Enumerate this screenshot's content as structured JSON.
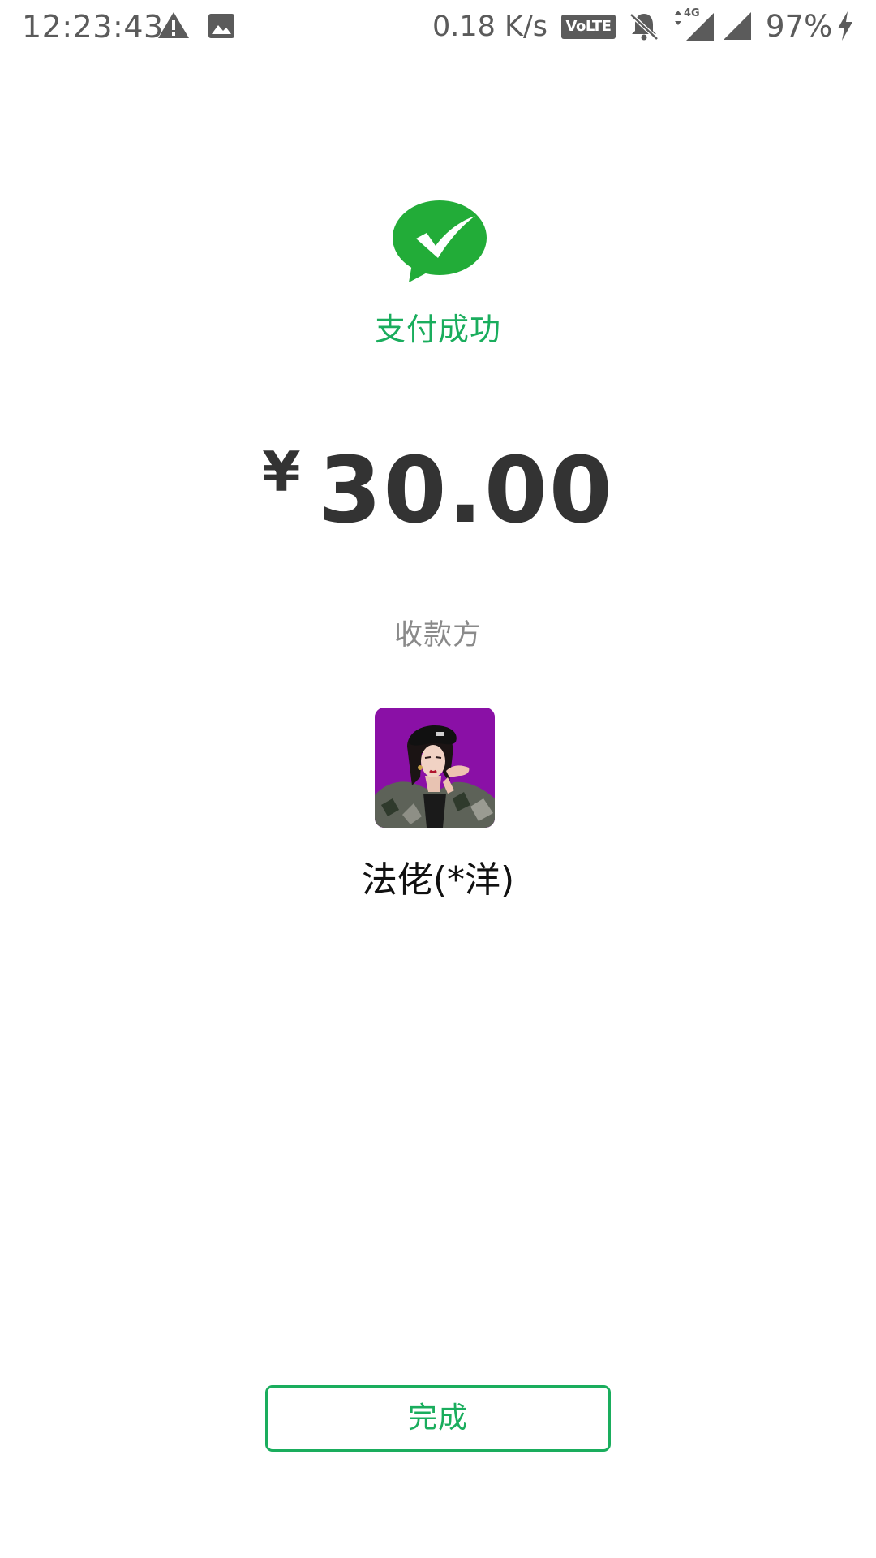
{
  "status_bar": {
    "time": "12:23:43",
    "network_speed": "0.18 K/s",
    "volte_label": "VoLTE",
    "network_type": "4G",
    "battery_percent": "97%",
    "icons": [
      "warning-icon",
      "image-icon",
      "volte-icon",
      "bell-off-icon",
      "4g-signal-icon",
      "signal-icon",
      "charging-icon"
    ]
  },
  "payment": {
    "status_text": "支付成功",
    "currency_symbol": "¥",
    "amount": "30.00",
    "payee_label": "收款方",
    "payee_name": "法佬(*洋)"
  },
  "actions": {
    "done_label": "完成"
  },
  "colors": {
    "accent_green": "#1aad5d",
    "amount_text": "#333333",
    "muted_text": "#8a8a8a",
    "avatar_background": "#8a10a6"
  }
}
